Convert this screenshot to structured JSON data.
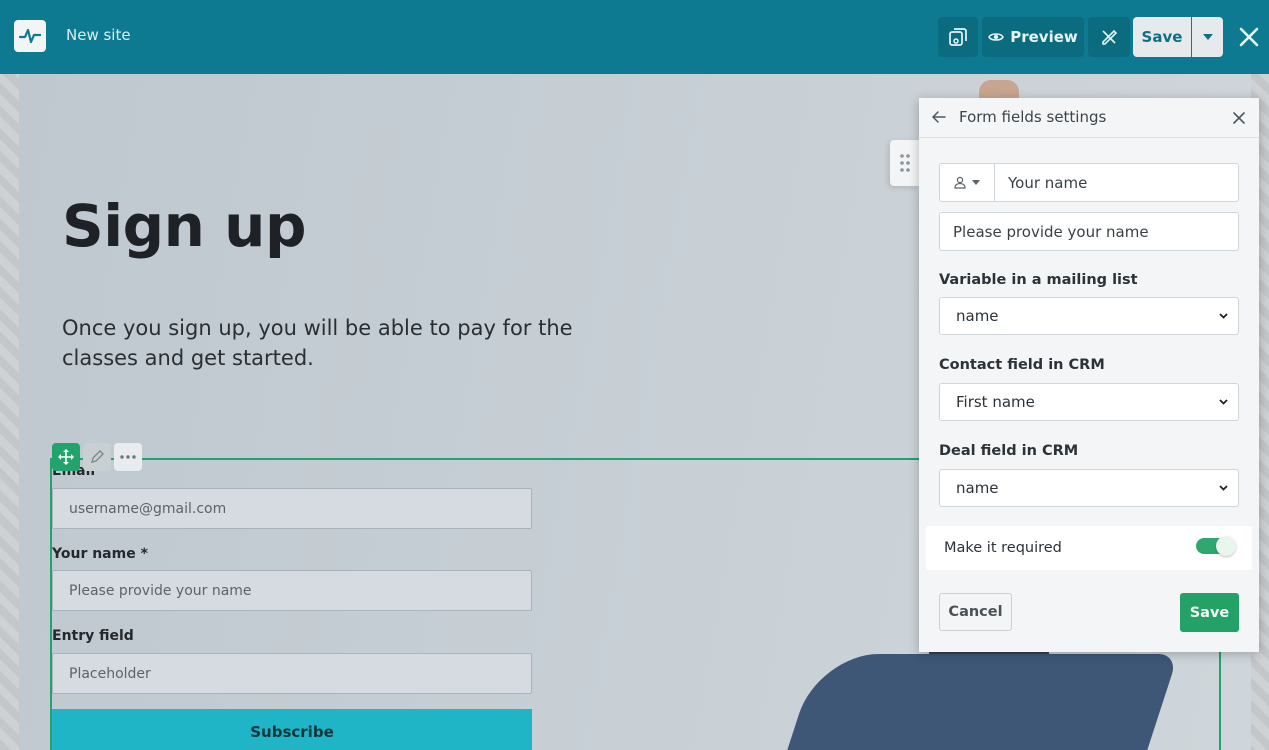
{
  "topbar": {
    "site_name": "New site",
    "preview_label": "Preview",
    "save_label": "Save"
  },
  "page": {
    "headline": "Sign up",
    "subtext": "Once you sign up, you will be able to pay for the classes and get started."
  },
  "form": {
    "email_label": "Email",
    "email_placeholder": "username@gmail.com",
    "name_label": "Your name *",
    "name_placeholder": "Please provide your name",
    "entry_label": "Entry field",
    "entry_placeholder": "Placeholder",
    "submit_label": "Subscribe"
  },
  "panel": {
    "title": "Form fields settings",
    "field_label_value": "Your name",
    "field_placeholder_value": "Please provide your name",
    "mailing_label": "Variable in a mailing list",
    "mailing_value": "name",
    "crm_contact_label": "Contact field in CRM",
    "crm_contact_value": "First name",
    "crm_deal_label": "Deal field in CRM",
    "crm_deal_value": "name",
    "required_label": "Make it required",
    "required_on": true,
    "cancel_label": "Cancel",
    "save_label": "Save"
  },
  "colors": {
    "topbar": "#0e7a91",
    "accent_green": "#24a166",
    "subscribe": "#1fb4c6"
  }
}
